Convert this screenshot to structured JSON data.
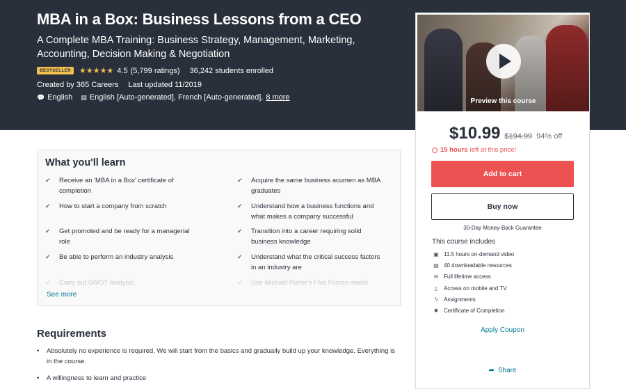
{
  "hero": {
    "title": "MBA in a Box: Business Lessons from a CEO",
    "subtitle": "A Complete MBA Training: Business Strategy, Management, Marketing, Accounting, Decision Making & Negotiation",
    "badge": "BESTSELLER",
    "stars": "★★★★★",
    "rating": "4.5",
    "rating_value": 4.5,
    "ratings_count": "(5,799 ratings)",
    "students": "36,242 students enrolled",
    "created_by": "Created by 365 Careers",
    "last_updated": "Last updated 11/2019",
    "language": "English",
    "captions": "English [Auto-generated], French [Auto-generated],",
    "more_link": "8 more",
    "colors": {
      "background": "#29303b",
      "star": "#f4c150",
      "badge": "#f4c150"
    }
  },
  "sidebar": {
    "preview_label": "Preview this course",
    "price": "$10.99",
    "original_price": "$194.99",
    "discount": "94% off",
    "timer_hours": "15 hours",
    "timer_rest": "left at this price!",
    "add_to_cart": "Add to cart",
    "buy_now": "Buy now",
    "guarantee": "30-Day Money-Back Guarantee",
    "includes_title": "This course includes",
    "includes": [
      {
        "icon": "video-icon",
        "label": "11.5 hours on-demand video"
      },
      {
        "icon": "file-icon",
        "label": "40 downloadable resources"
      },
      {
        "icon": "infinity-icon",
        "label": "Full lifetime access"
      },
      {
        "icon": "mobile-icon",
        "label": "Access on mobile and TV"
      },
      {
        "icon": "bolt-icon",
        "label": "Assignments"
      },
      {
        "icon": "award-icon",
        "label": "Certificate of Completion"
      }
    ],
    "apply_coupon": "Apply Coupon",
    "share": "Share",
    "colors": {
      "cart_button": "#ec5252",
      "link": "#007791",
      "timer": "#ec5252"
    }
  },
  "learn": {
    "title": "What you'll learn",
    "left": [
      "Receive an 'MBA in a Box' certificate of completion",
      "How to start a company from scratch",
      "Get promoted and be ready for a managerial role",
      "Be able to perform an industry analysis",
      "Carry out SWOT analysis"
    ],
    "right": [
      "Acquire the same business acumen as MBA graduates",
      "Understand how a business functions and what makes a company successful",
      "Transition into a career requiring solid business knowledge",
      "Understand what the critical success factors in an industry are",
      "Use Michael Porter's Five Forces model"
    ],
    "see_more": "See more"
  },
  "requirements": {
    "title": "Requirements",
    "items": [
      "Absolutely no experience is required. We will start from the basics and gradually build up your knowledge. Everything is in the course.",
      "A willingness to learn and practice"
    ]
  }
}
